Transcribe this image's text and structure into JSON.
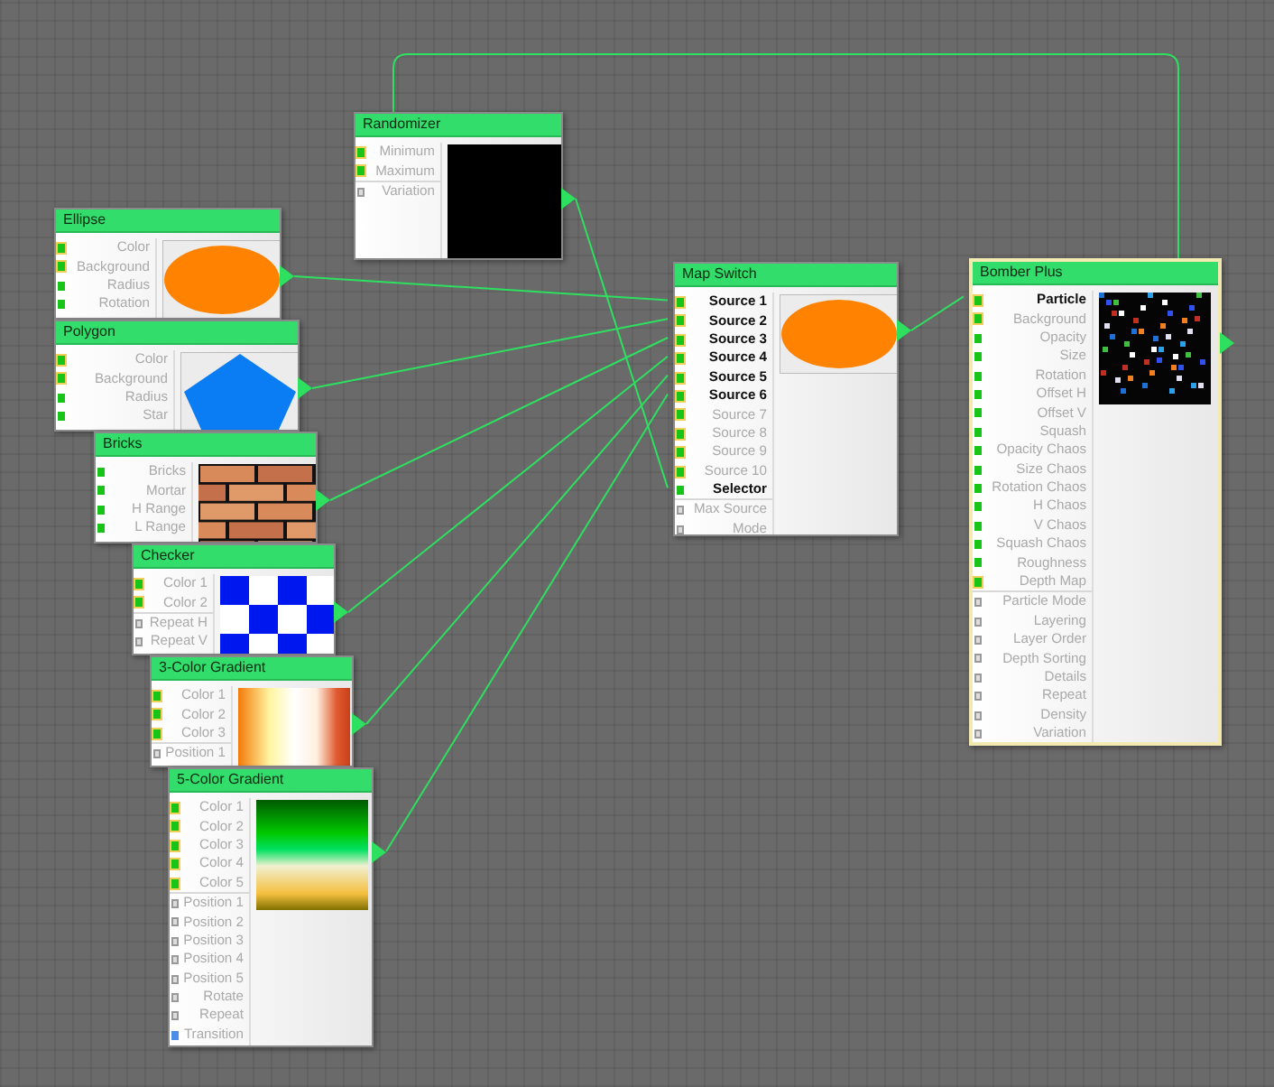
{
  "nodes": [
    {
      "title": "Randomizer",
      "kind": "randomizer",
      "selected": false,
      "params": [
        {
          "label": "Minimum",
          "kind": "map",
          "connected": false
        },
        {
          "label": "Maximum",
          "kind": "map",
          "connected": false
        },
        {
          "label": "Variation",
          "kind": "setting",
          "connected": false
        }
      ]
    },
    {
      "title": "Ellipse",
      "kind": "ellipse",
      "selected": false,
      "params": [
        {
          "label": "Color",
          "kind": "map",
          "connected": false
        },
        {
          "label": "Background",
          "kind": "map",
          "connected": false
        },
        {
          "label": "Radius",
          "kind": "scalar",
          "connected": false
        },
        {
          "label": "Rotation",
          "kind": "scalar",
          "connected": false
        }
      ]
    },
    {
      "title": "Polygon",
      "kind": "pentagon",
      "selected": false,
      "params": [
        {
          "label": "Color",
          "kind": "map",
          "connected": false
        },
        {
          "label": "Background",
          "kind": "map",
          "connected": false
        },
        {
          "label": "Radius",
          "kind": "scalar",
          "connected": false
        },
        {
          "label": "Star",
          "kind": "scalar",
          "connected": false
        }
      ]
    },
    {
      "title": "Bricks",
      "kind": "bricks",
      "selected": false,
      "params": [
        {
          "label": "Bricks",
          "kind": "scalar",
          "connected": false
        },
        {
          "label": "Mortar",
          "kind": "scalar",
          "connected": false
        },
        {
          "label": "H Range",
          "kind": "scalar",
          "connected": false
        },
        {
          "label": "L Range",
          "kind": "scalar",
          "connected": false
        }
      ]
    },
    {
      "title": "Checker",
      "kind": "checker",
      "selected": false,
      "params": [
        {
          "label": "Color 1",
          "kind": "map",
          "connected": false
        },
        {
          "label": "Color 2",
          "kind": "map",
          "connected": false
        },
        {
          "label": "Repeat H",
          "kind": "setting",
          "connected": false
        },
        {
          "label": "Repeat V",
          "kind": "setting",
          "connected": false
        }
      ]
    },
    {
      "title": "3-Color Gradient",
      "kind": "gradient3",
      "selected": false,
      "params": [
        {
          "label": "Color 1",
          "kind": "map",
          "connected": false
        },
        {
          "label": "Color 2",
          "kind": "map",
          "connected": false
        },
        {
          "label": "Color 3",
          "kind": "map",
          "connected": false
        },
        {
          "label": "Position 1",
          "kind": "setting",
          "connected": false
        }
      ]
    },
    {
      "title": "5-Color Gradient",
      "kind": "gradient5",
      "selected": false,
      "params": [
        {
          "label": "Color 1",
          "kind": "map",
          "connected": false
        },
        {
          "label": "Color 2",
          "kind": "map",
          "connected": false
        },
        {
          "label": "Color 3",
          "kind": "map",
          "connected": false
        },
        {
          "label": "Color 4",
          "kind": "map",
          "connected": false
        },
        {
          "label": "Color 5",
          "kind": "map",
          "connected": false
        },
        {
          "label": "Position 1",
          "kind": "setting",
          "connected": false
        },
        {
          "label": "Position 2",
          "kind": "setting",
          "connected": false
        },
        {
          "label": "Position 3",
          "kind": "setting",
          "connected": false
        },
        {
          "label": "Position 4",
          "kind": "setting",
          "connected": false
        },
        {
          "label": "Position 5",
          "kind": "setting",
          "connected": false
        },
        {
          "label": "Rotate",
          "kind": "setting",
          "connected": false
        },
        {
          "label": "Repeat",
          "kind": "setting",
          "connected": false
        },
        {
          "label": "Transition",
          "kind": "gradient",
          "connected": false
        }
      ]
    },
    {
      "title": "Map Switch",
      "kind": "ellipse",
      "selected": false,
      "params": [
        {
          "label": "Source 1",
          "kind": "map",
          "connected": true
        },
        {
          "label": "Source 2",
          "kind": "map",
          "connected": true
        },
        {
          "label": "Source 3",
          "kind": "map",
          "connected": true
        },
        {
          "label": "Source 4",
          "kind": "map",
          "connected": true
        },
        {
          "label": "Source 5",
          "kind": "map",
          "connected": true
        },
        {
          "label": "Source 6",
          "kind": "map",
          "connected": true
        },
        {
          "label": "Source 7",
          "kind": "map",
          "connected": false
        },
        {
          "label": "Source 8",
          "kind": "map",
          "connected": false
        },
        {
          "label": "Source 9",
          "kind": "map",
          "connected": false
        },
        {
          "label": "Source 10",
          "kind": "map",
          "connected": false
        },
        {
          "label": "Selector",
          "kind": "scalar",
          "connected": true
        },
        {
          "label": "Max Source",
          "kind": "setting",
          "connected": false
        },
        {
          "label": "Mode",
          "kind": "setting",
          "connected": false
        }
      ]
    },
    {
      "title": "Bomber Plus",
      "kind": "bomber",
      "selected": true,
      "params": [
        {
          "label": "Particle",
          "kind": "map",
          "connected": true
        },
        {
          "label": "Background",
          "kind": "map",
          "connected": false
        },
        {
          "label": "Opacity",
          "kind": "scalar",
          "connected": false
        },
        {
          "label": "Size",
          "kind": "scalar",
          "connected": false
        },
        {
          "label": "Rotation",
          "kind": "scalar",
          "connected": false
        },
        {
          "label": "Offset H",
          "kind": "scalar",
          "connected": false
        },
        {
          "label": "Offset V",
          "kind": "scalar",
          "connected": false
        },
        {
          "label": "Squash",
          "kind": "scalar",
          "connected": false
        },
        {
          "label": "Opacity Chaos",
          "kind": "scalar",
          "connected": false
        },
        {
          "label": "Size Chaos",
          "kind": "scalar",
          "connected": false
        },
        {
          "label": "Rotation Chaos",
          "kind": "scalar",
          "connected": false
        },
        {
          "label": "H Chaos",
          "kind": "scalar",
          "connected": false
        },
        {
          "label": "V Chaos",
          "kind": "scalar",
          "connected": false
        },
        {
          "label": "Squash Chaos",
          "kind": "scalar",
          "connected": false
        },
        {
          "label": "Roughness",
          "kind": "scalar",
          "connected": false
        },
        {
          "label": "Depth Map",
          "kind": "map",
          "connected": false
        },
        {
          "label": "Particle Mode",
          "kind": "setting",
          "connected": false
        },
        {
          "label": "Layering",
          "kind": "setting",
          "connected": false
        },
        {
          "label": "Layer Order",
          "kind": "setting",
          "connected": false
        },
        {
          "label": "Depth Sorting",
          "kind": "setting",
          "connected": false
        },
        {
          "label": "Details",
          "kind": "setting",
          "connected": false
        },
        {
          "label": "Repeat",
          "kind": "setting",
          "connected": false
        },
        {
          "label": "Density",
          "kind": "setting",
          "connected": false
        },
        {
          "label": "Variation",
          "kind": "setting",
          "connected": false
        }
      ]
    }
  ]
}
